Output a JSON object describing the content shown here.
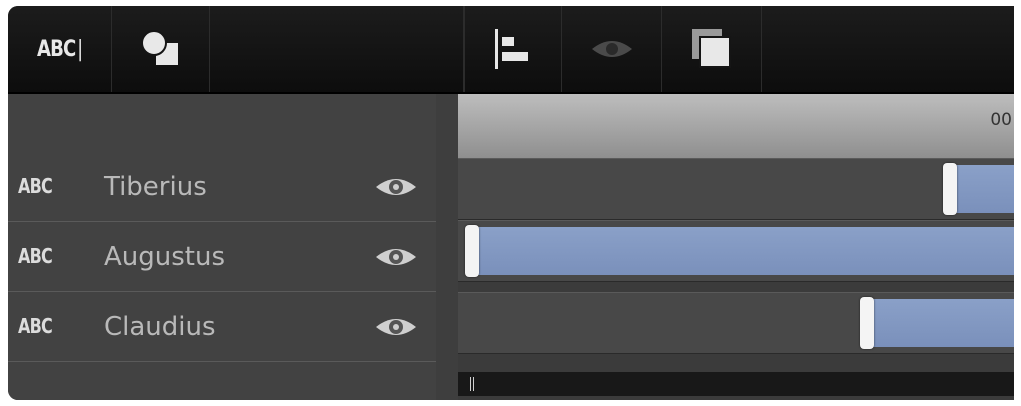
{
  "toolbar": {
    "text_tool_icon": "abc-text-icon",
    "text_tool_label": "ABC",
    "shapes_icon": "shapes-icon",
    "align_icon": "align-left-icon",
    "visibility_icon": "eye-icon",
    "duplicate_icon": "copy-icon"
  },
  "timeline": {
    "ruler_label": "00"
  },
  "layers": [
    {
      "type_label": "ABC",
      "name": "Tiberius",
      "visible": true,
      "clip_start_fraction": 0.88
    },
    {
      "type_label": "ABC",
      "name": "Augustus",
      "visible": true,
      "clip_start_fraction": 0.02
    },
    {
      "type_label": "ABC",
      "name": "Claudius",
      "visible": true,
      "clip_start_fraction": 0.73
    }
  ],
  "colors": {
    "clip": "#7a90bb",
    "toolbar": "#111111",
    "panel": "#424242"
  }
}
